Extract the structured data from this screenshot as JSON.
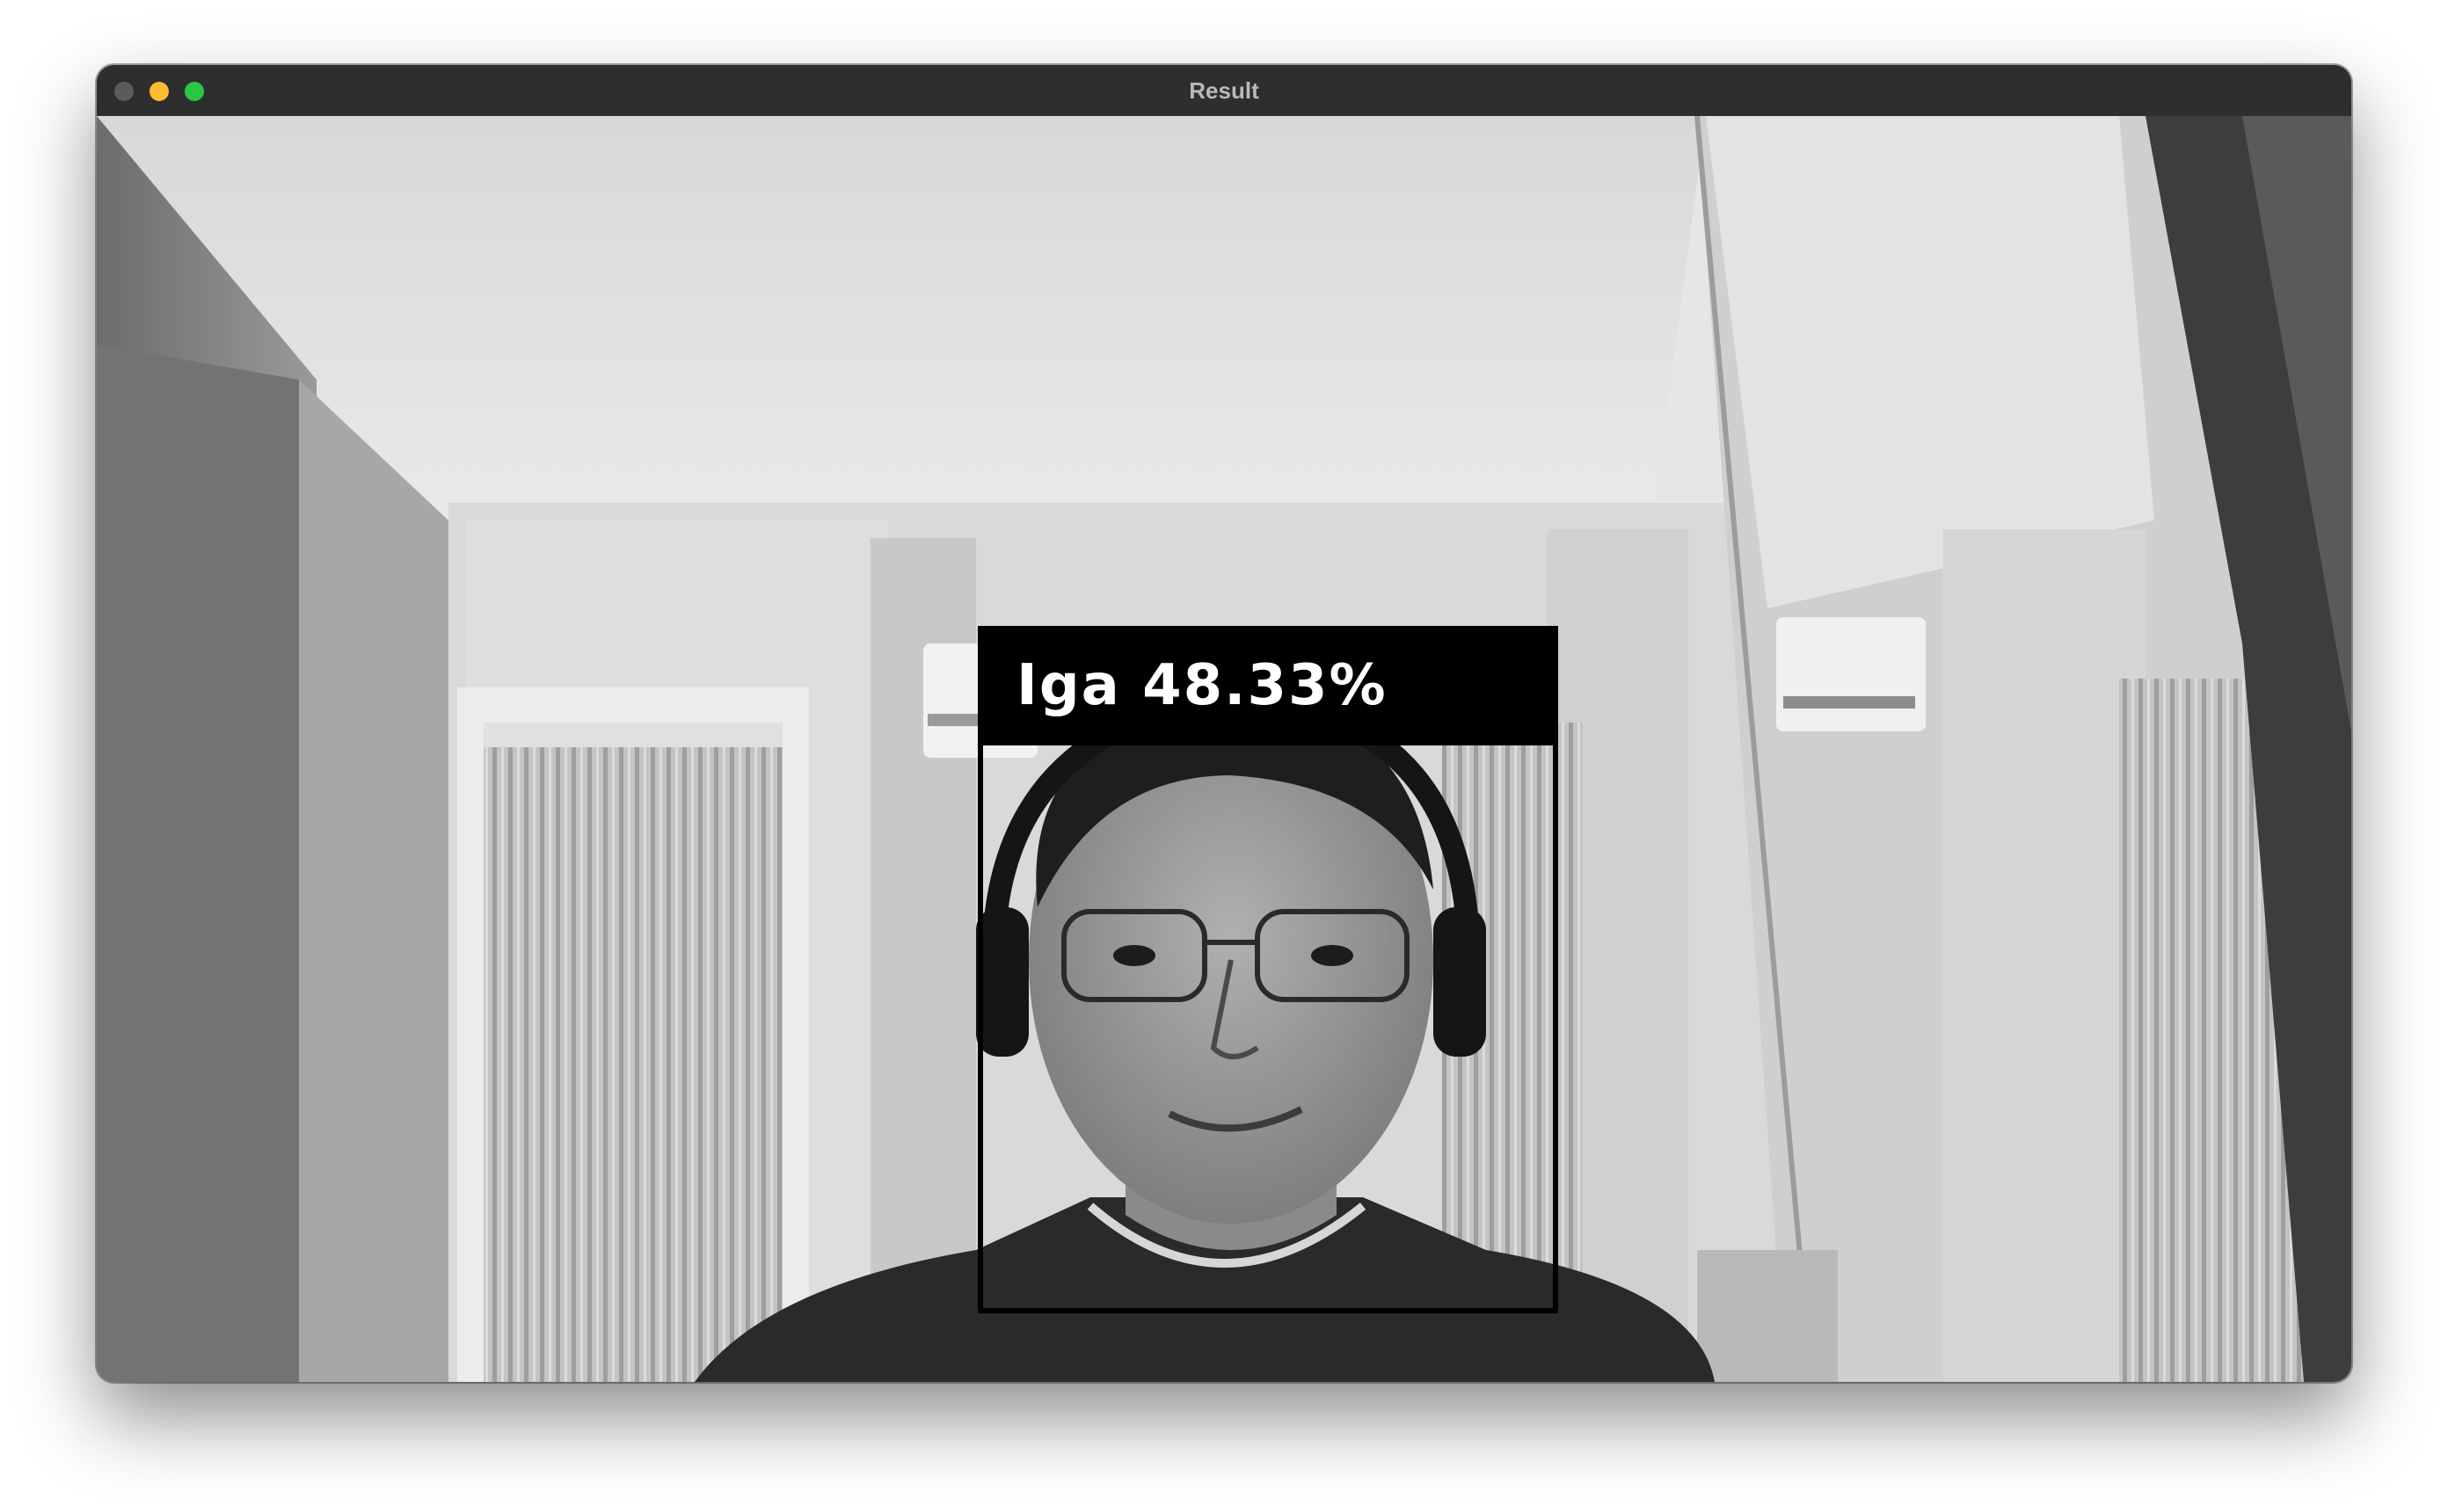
{
  "window": {
    "title": "Result",
    "buttons": [
      "close",
      "minimize",
      "maximize"
    ],
    "colors": {
      "titlebar": "#2e2e2e",
      "title_text": "#b9b9b9",
      "close": "#5b5b5b",
      "minimize": "#febc2e",
      "maximize": "#28c840"
    }
  },
  "frame": {
    "mode": "grayscale webcam frame",
    "detection": {
      "label": "Iga 48.33%",
      "name": "Iga",
      "confidence_percent": 48.33,
      "box_color": "#000000",
      "text_color": "#ffffff"
    }
  }
}
